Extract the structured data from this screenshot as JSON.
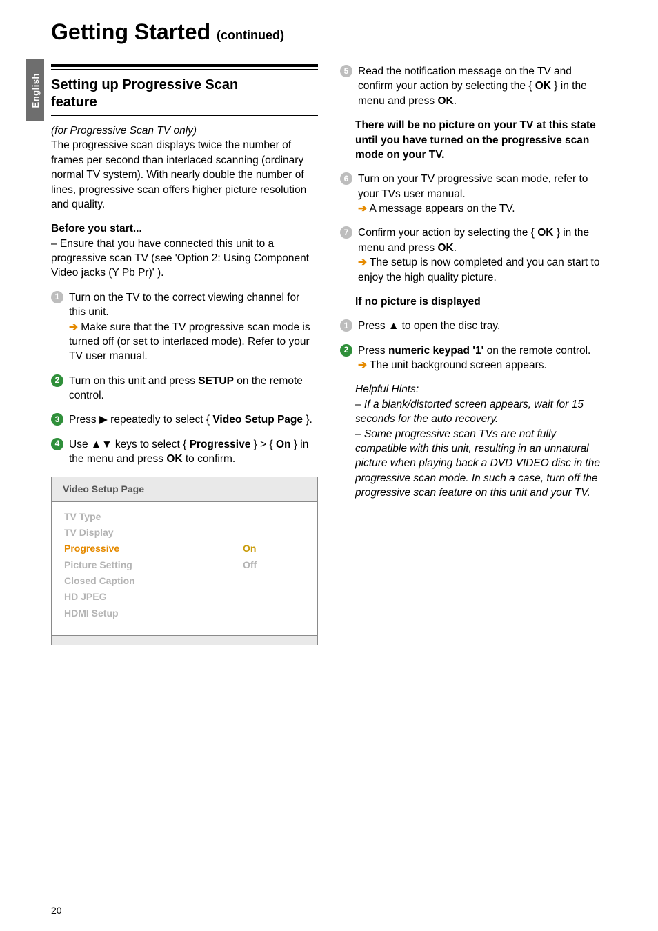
{
  "tab": "English",
  "title_main": "Getting Started",
  "title_cont": "(continued)",
  "section_heading_l1": "Setting up Progressive Scan",
  "section_heading_l2": "feature",
  "left": {
    "p1_italic": "(for Progressive Scan TV only)",
    "p1_rest": "The progressive scan displays twice the number of frames per second than interlaced scanning (ordinary normal TV system). With nearly double the number of lines, progressive scan offers higher picture resolution and quality.",
    "before_h": "Before you start...",
    "before_body": "–   Ensure that you have connected this unit to a progressive scan TV (see 'Option 2: Using Component Video jacks (Y Pb Pr)' ).",
    "s1a": "Turn on the TV to the correct viewing channel for this unit.",
    "s1b": " Make sure that the TV progressive scan mode is turned off (or set to interlaced mode). Refer to your TV user manual.",
    "s2a": "Turn on this unit and press ",
    "s2b": "SETUP",
    "s2c": " on the remote control.",
    "s3a": "Press ",
    "s3b": " repeatedly to select { ",
    "s3c": "Video Setup Page",
    "s3d": " }.",
    "s4a": "Use ",
    "s4b": " keys to select { ",
    "s4c": "Progressive",
    "s4d": " } > { ",
    "s4e": "On",
    "s4f": " } in the menu and press ",
    "s4g": "OK",
    "s4h": " to confirm."
  },
  "menu": {
    "head": "Video Setup Page",
    "rows": [
      {
        "l": "TV Type",
        "r": ""
      },
      {
        "l": "TV Display",
        "r": ""
      },
      {
        "l": "Progressive",
        "r": "On",
        "active": true
      },
      {
        "l": "Picture Setting",
        "r": "Off"
      },
      {
        "l": "Closed Caption",
        "r": ""
      },
      {
        "l": "HD JPEG",
        "r": ""
      },
      {
        "l": "HDMI Setup",
        "r": ""
      }
    ]
  },
  "right": {
    "s5a": "Read the notification message on the TV and confirm your action by selecting the { ",
    "s5b": "OK",
    "s5c": " } in the menu and press ",
    "s5d": "OK",
    "s5e": ".",
    "warn": "There will be no picture on your TV at this state until you have turned on the progressive scan mode on your TV.",
    "s6a": "Turn on your TV progressive scan mode, refer to your TVs user manual.",
    "s6b": " A message appears on the TV.",
    "s7a": "Confirm your action by selecting the { ",
    "s7b": "OK",
    "s7c": " } in the menu and press ",
    "s7d": "OK",
    "s7e": ".",
    "s7f": " The setup is now completed and you can start to enjoy the high quality picture.",
    "nopic_h": "If no picture is displayed",
    "np1a": "Press ",
    "np1b": " to open the disc tray.",
    "np2a": "Press ",
    "np2b": "numeric keypad '1'",
    "np2c": " on the remote control.",
    "np2d": " The unit background screen appears.",
    "hints_h": "Helpful Hints:",
    "hints_1": "–    If a blank/distorted screen appears, wait for 15 seconds for the auto recovery.",
    "hints_2": "–   Some progressive scan TVs are not fully compatible with this unit, resulting in an unnatural picture when playing back a DVD VIDEO disc in the progressive scan mode. In such a case, turn off the progressive scan feature on this unit and your TV."
  },
  "page_number": "20"
}
